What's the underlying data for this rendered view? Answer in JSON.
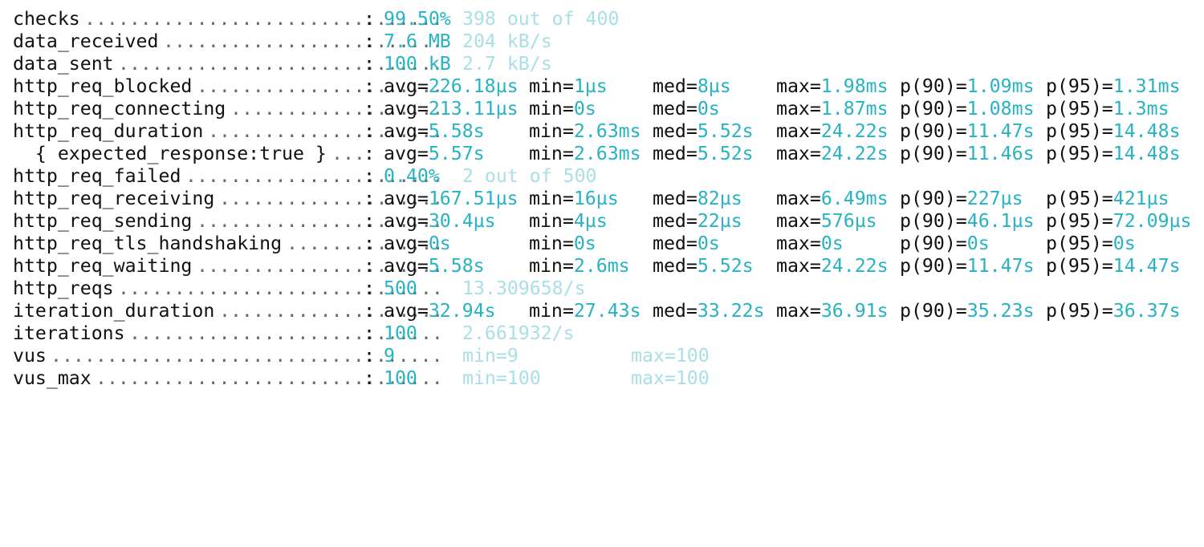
{
  "colors": {
    "foreground": "#111111",
    "value_cyan": "#26b3c2",
    "secondary_faint_cyan": "#a9dfe6",
    "background": "#ffffff"
  },
  "metrics": [
    {
      "name": "checks",
      "dots": "................................",
      "colon": ":",
      "v1": "99.50%",
      "v2": "398 out of 400"
    },
    {
      "name": "data_received",
      "dots": ".........................",
      "colon": ":",
      "v1": "7.6 MB",
      "v2": "204 kB/s"
    },
    {
      "name": "data_sent",
      "dots": ".............................",
      "colon": ":",
      "v1": "100 kB",
      "v2": "2.7 kB/s"
    },
    {
      "name": "http_req_blocked",
      "dots": "......................",
      "colon": ":",
      "stats": {
        "avg": "226.18µs",
        "min": "1µs",
        "med": "8µs",
        "max": "1.98ms",
        "p90": "1.09ms",
        "p95": "1.31ms"
      }
    },
    {
      "name": "http_req_connecting",
      "dots": "...................",
      "colon": ":",
      "stats": {
        "avg": "213.11µs",
        "min": "0s",
        "med": "0s",
        "max": "1.87ms",
        "p90": "1.08ms",
        "p95": "1.3ms"
      }
    },
    {
      "name": "http_req_duration",
      "dots": ".....................",
      "colon": ":",
      "stats": {
        "avg": "5.58s",
        "min": "2.63ms",
        "med": "5.52s",
        "max": "24.22s",
        "p90": "11.47s",
        "p95": "14.48s"
      }
    },
    {
      "name": "  { expected_response:true }",
      "dots": "...",
      "colon": ":",
      "stats": {
        "avg": "5.57s",
        "min": "2.63ms",
        "med": "5.52s",
        "max": "24.22s",
        "p90": "11.46s",
        "p95": "14.48s"
      }
    },
    {
      "name": "http_req_failed",
      "dots": ".......................",
      "colon": ":",
      "v1": "0.40%",
      "v2": "2 out of 500"
    },
    {
      "name": "http_req_receiving",
      "dots": "....................",
      "colon": ":",
      "stats": {
        "avg": "167.51µs",
        "min": "16µs",
        "med": "82µs",
        "max": "6.49ms",
        "p90": "227µs",
        "p95": "421µs"
      }
    },
    {
      "name": "http_req_sending",
      "dots": "......................",
      "colon": ":",
      "stats": {
        "avg": "30.4µs",
        "min": "4µs",
        "med": "22µs",
        "max": "576µs",
        "p90": "46.1µs",
        "p95": "72.09µs"
      }
    },
    {
      "name": "http_req_tls_handshaking",
      "dots": "..............",
      "colon": ":",
      "stats": {
        "avg": "0s",
        "min": "0s",
        "med": "0s",
        "max": "0s",
        "p90": "0s",
        "p95": "0s"
      }
    },
    {
      "name": "http_req_waiting",
      "dots": "......................",
      "colon": ":",
      "stats": {
        "avg": "5.58s",
        "min": "2.6ms",
        "med": "5.52s",
        "max": "24.22s",
        "p90": "11.47s",
        "p95": "14.47s"
      }
    },
    {
      "name": "http_reqs",
      "dots": ".............................",
      "colon": ":",
      "v1": "500",
      "v2": "13.309658/s"
    },
    {
      "name": "iteration_duration",
      "dots": "....................",
      "colon": ":",
      "stats": {
        "avg": "32.94s",
        "min": "27.43s",
        "med": "33.22s",
        "max": "36.91s",
        "p90": "35.23s",
        "p95": "36.37s"
      }
    },
    {
      "name": "iterations",
      "dots": "............................",
      "colon": ":",
      "v1": "100",
      "v2": "2.661932/s"
    },
    {
      "name": "vus",
      "dots": "...................................",
      "colon": ":",
      "v1": "9",
      "vmin": "min=9",
      "vmax": "max=100"
    },
    {
      "name": "vus_max",
      "dots": "...............................",
      "colon": ":",
      "v1": "100",
      "vmin": "min=100",
      "vmax": "max=100"
    }
  ]
}
